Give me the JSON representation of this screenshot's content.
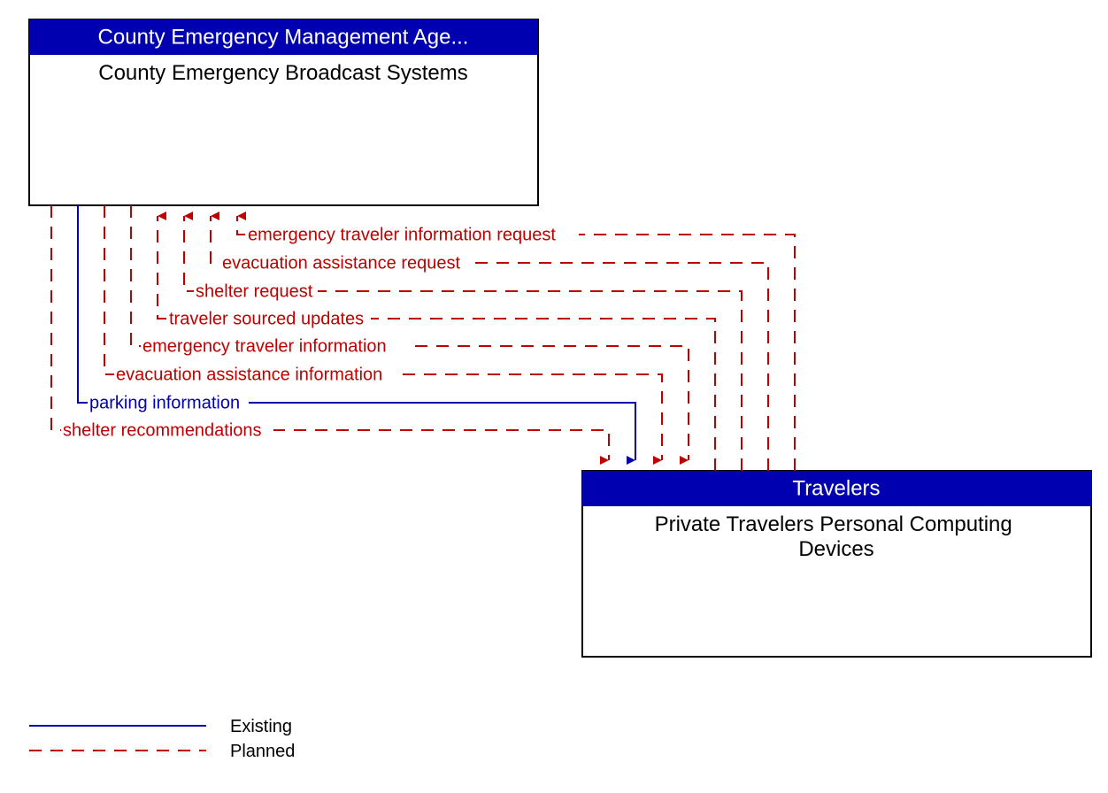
{
  "entity_top": {
    "header": "County Emergency Management Age...",
    "name": "County Emergency Broadcast Systems"
  },
  "entity_bottom": {
    "header": "Travelers",
    "name": "Private Travelers Personal Computing Devices"
  },
  "flows": [
    {
      "label": "emergency traveler information request",
      "status": "planned",
      "direction": "to_top"
    },
    {
      "label": "evacuation assistance request",
      "status": "planned",
      "direction": "to_top"
    },
    {
      "label": "shelter request",
      "status": "planned",
      "direction": "to_top"
    },
    {
      "label": "traveler sourced updates",
      "status": "planned",
      "direction": "to_top"
    },
    {
      "label": "emergency traveler information",
      "status": "planned",
      "direction": "to_bottom"
    },
    {
      "label": "evacuation assistance information",
      "status": "planned",
      "direction": "to_bottom"
    },
    {
      "label": "parking information",
      "status": "existing",
      "direction": "to_bottom"
    },
    {
      "label": "shelter recommendations",
      "status": "planned",
      "direction": "to_bottom"
    }
  ],
  "legend": {
    "existing": "Existing",
    "planned": "Planned"
  },
  "colors": {
    "header_bg": "#0000b0",
    "existing": "#0000b0",
    "planned": "#c00000"
  }
}
